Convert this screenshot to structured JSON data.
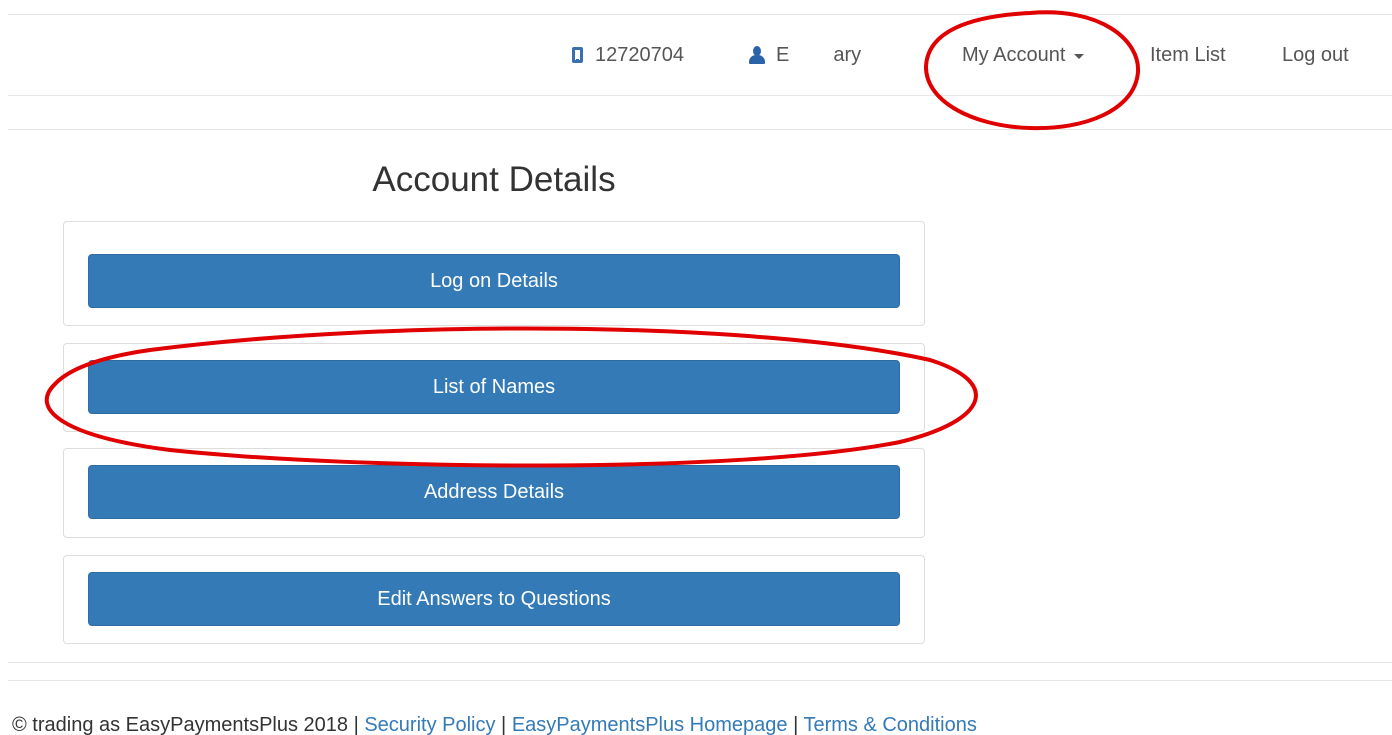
{
  "header": {
    "phone_number": "12720704",
    "user_name_start": "E",
    "user_name_end": "ary",
    "my_account_label": "My Account",
    "item_list_label": "Item List",
    "log_out_label": "Log out"
  },
  "main": {
    "title": "Account Details",
    "buttons": [
      {
        "label": "Log on Details"
      },
      {
        "label": "List of Names"
      },
      {
        "label": "Address Details"
      },
      {
        "label": "Edit Answers to Questions"
      }
    ]
  },
  "footer": {
    "copyright": "© trading as EasyPaymentsPlus 2018 | ",
    "security_policy": "Security Policy",
    "sep1": " | ",
    "homepage": "EasyPaymentsPlus Homepage",
    "sep2": " | ",
    "terms": "Terms & Conditions"
  },
  "colors": {
    "primary_button": "#337ab7",
    "annotation_red": "#e00000",
    "icon_blue": "#2a63a8"
  }
}
